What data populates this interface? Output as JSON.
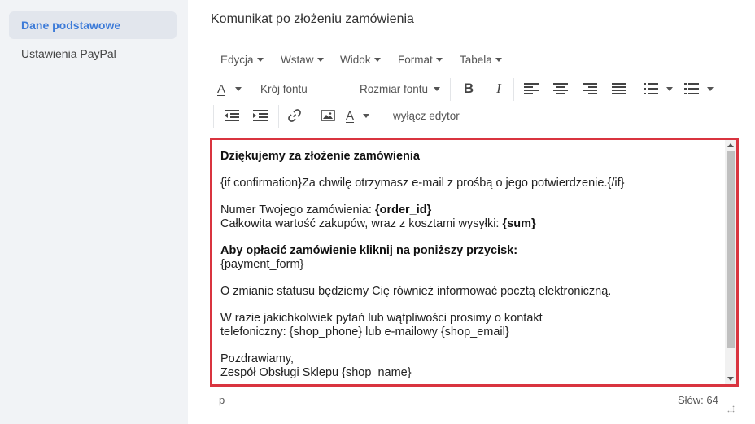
{
  "sidebar": {
    "items": [
      {
        "label": "Dane podstawowe",
        "active": true
      },
      {
        "label": "Ustawienia PayPal",
        "active": false
      }
    ]
  },
  "section": {
    "title": "Komunikat po złożeniu zamówienia"
  },
  "menubar": {
    "items": [
      "Edycja",
      "Wstaw",
      "Widok",
      "Format",
      "Tabela"
    ]
  },
  "toolbar": {
    "font_family": "Krój fontu",
    "font_size": "Rozmiar fontu",
    "disable_editor": "wyłącz edytor",
    "text_color_letter": "A",
    "bg_color_letter": "A",
    "bold": "B",
    "italic": "I"
  },
  "colors": {
    "accent": "#3d7bd8",
    "highlight_border": "#d9343f"
  },
  "content": {
    "heading": "Dziękujemy za złożenie zamówienia",
    "confirmation_line": "{if confirmation}Za chwilę otrzymasz e-mail z prośbą o jego potwierdzenie.{/if}",
    "order_label": "Numer Twojego zamówienia: ",
    "order_var": "{order_id}",
    "sum_label": "Całkowita wartość zakupów, wraz z kosztami wysyłki: ",
    "sum_var": "{sum}",
    "pay_heading": "Aby opłacić zamówienie kliknij na poniższy przycisk:",
    "payment_form": "{payment_form}",
    "status_info": "O zmianie statusu będziemy Cię również informować pocztą elektroniczną.",
    "questions_1": "W razie jakichkolwiek pytań lub wątpliwości prosimy o kontakt",
    "questions_2": "telefoniczny: {shop_phone} lub e-mailowy {shop_email}",
    "greeting": "Pozdrawiamy,",
    "signature": "Zespół Obsługi Sklepu {shop_name}"
  },
  "statusbar": {
    "path": "p",
    "word_count": "Słów: 64"
  }
}
